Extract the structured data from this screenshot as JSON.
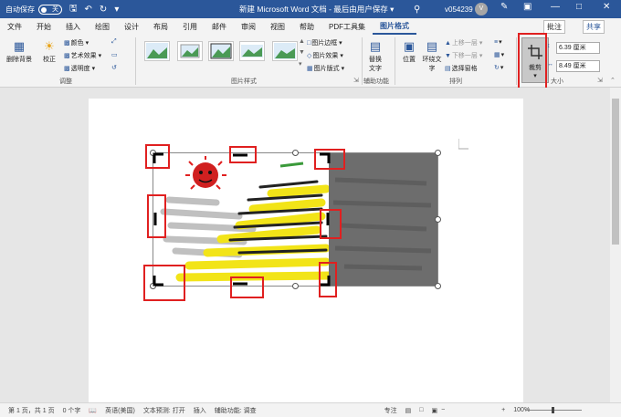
{
  "titlebar": {
    "autosave_label": "自动保存",
    "autosave_state": "关",
    "document_title": "新建 Microsoft Word 文档  -  最后由用户保存  ▾",
    "user_name": "v054239",
    "avatar_letter": "V"
  },
  "tabs": [
    "文件",
    "开始",
    "插入",
    "绘图",
    "设计",
    "布局",
    "引用",
    "邮件",
    "审阅",
    "视图",
    "帮助",
    "PDF工具集",
    "图片格式"
  ],
  "tab_actions": {
    "comment": "批注",
    "share": "共享"
  },
  "ribbon": {
    "remove_bg": "删除背景",
    "corrections": "校正",
    "color": "颜色",
    "artistic_effects": "艺术效果",
    "transparency": "透明度",
    "group_adjust": "调整",
    "group_styles": "图片样式",
    "picture_border": "图片边框",
    "picture_effects": "图片效果",
    "picture_layout": "图片版式",
    "alt_text_1": "替换",
    "alt_text_2": "文字",
    "group_accessibility": "辅助功能",
    "position": "位置",
    "wrap_text_1": "环绕文",
    "wrap_text_2": "字",
    "bring_forward": "上移一层",
    "send_backward": "下移一层",
    "selection_pane": "选择窗格",
    "group_arrange": "排列",
    "crop": "裁剪",
    "height": "6.39 厘米",
    "width": "8.49 厘米",
    "group_size": "大小"
  },
  "status": {
    "page": "第 1 页，共 1 页",
    "words": "0 个字",
    "language": "英语(美国)",
    "text_prediction": "文本预测: 打开",
    "insert_mode": "插入",
    "accessibility": "辅助功能: 调查",
    "focus": "专注",
    "zoom": "100%"
  },
  "colors": {
    "accent": "#2b579a",
    "highlight_box": "#e02020"
  }
}
